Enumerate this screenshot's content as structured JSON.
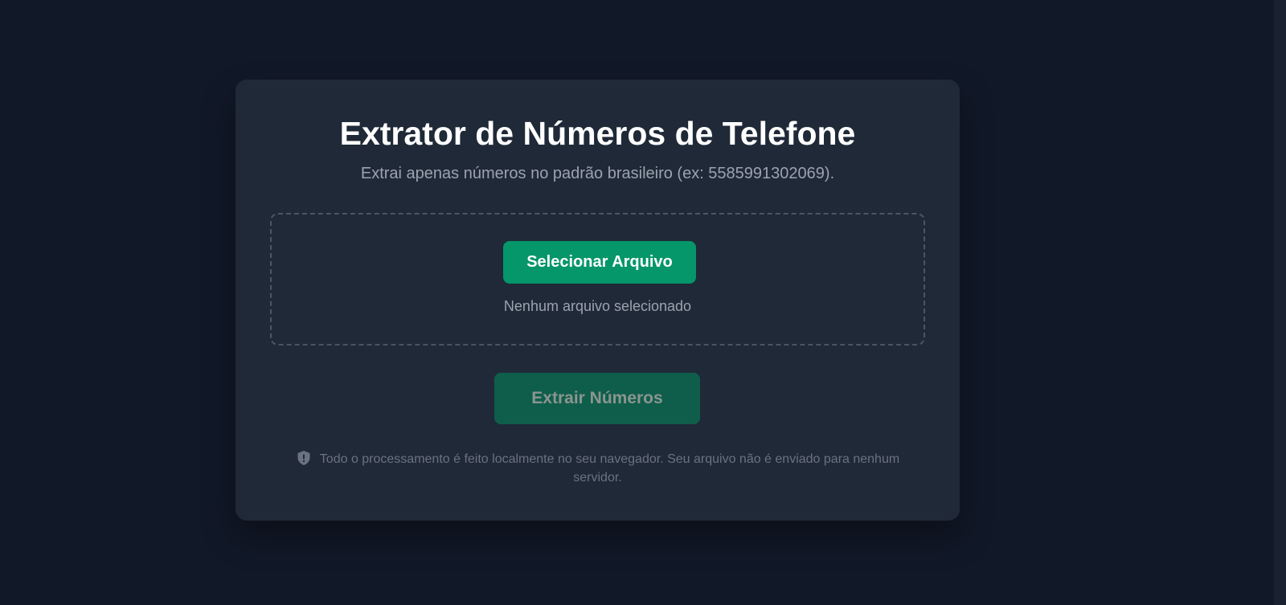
{
  "app": {
    "title": "Extrator de Números de Telefone",
    "subtitle": "Extrai apenas números no padrão brasileiro (ex: 5585991302069)."
  },
  "upload": {
    "select_label": "Selecionar Arquivo",
    "status_text": "Nenhum arquivo selecionado"
  },
  "actions": {
    "extract_label": "Extrair Números",
    "extract_disabled": true
  },
  "notice": {
    "icon": "shield-icon",
    "text": "Todo o processamento é feito localmente no seu navegador. Seu arquivo não é enviado para nenhum servidor."
  },
  "colors": {
    "background": "#111827",
    "card": "#1f2937",
    "accent": "#059669",
    "accent_disabled": "#0f5e4b"
  }
}
